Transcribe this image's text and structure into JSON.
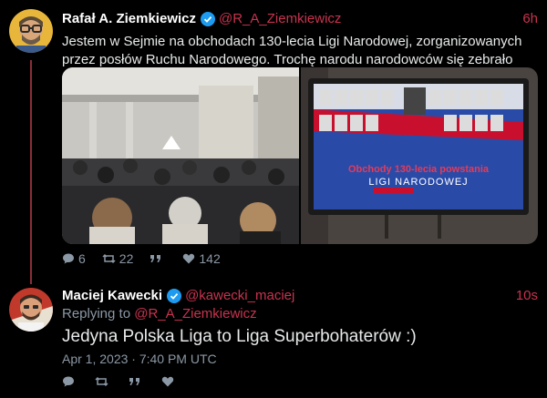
{
  "tweet1": {
    "name": "Rafał A. Ziemkiewicz",
    "handle": "@R_A_Ziemkiewicz",
    "time": "6h",
    "text_line1": "Jestem w Sejmie na obchodach 130-lecia Ligi Narodowej, zorganizowanych",
    "text_line2": "przez posłów Ruchu Narodowego. Trochę narodu narodowców się zebrało",
    "screen_title": "Obchody 130-lecia powstania",
    "screen_subtitle": "LIGI NARODOWEJ",
    "replies": "6",
    "retweets": "22",
    "quotes_icon": "quote-icon",
    "likes": "142"
  },
  "tweet2": {
    "name": "Maciej Kawecki",
    "handle": "@kawecki_maciej",
    "time": "10s",
    "replying_label": "Replying to",
    "replying_handle": "@R_A_Ziemkiewicz",
    "text": "Jedyna Polska Liga to Liga Superbohaterów :)",
    "date": "Apr 1, 2023 · 7:40 PM UTC"
  },
  "colors": {
    "accent": "#c8334f",
    "verified": "#1d9bf0",
    "muted": "#8b98a5",
    "background": "#000000"
  }
}
